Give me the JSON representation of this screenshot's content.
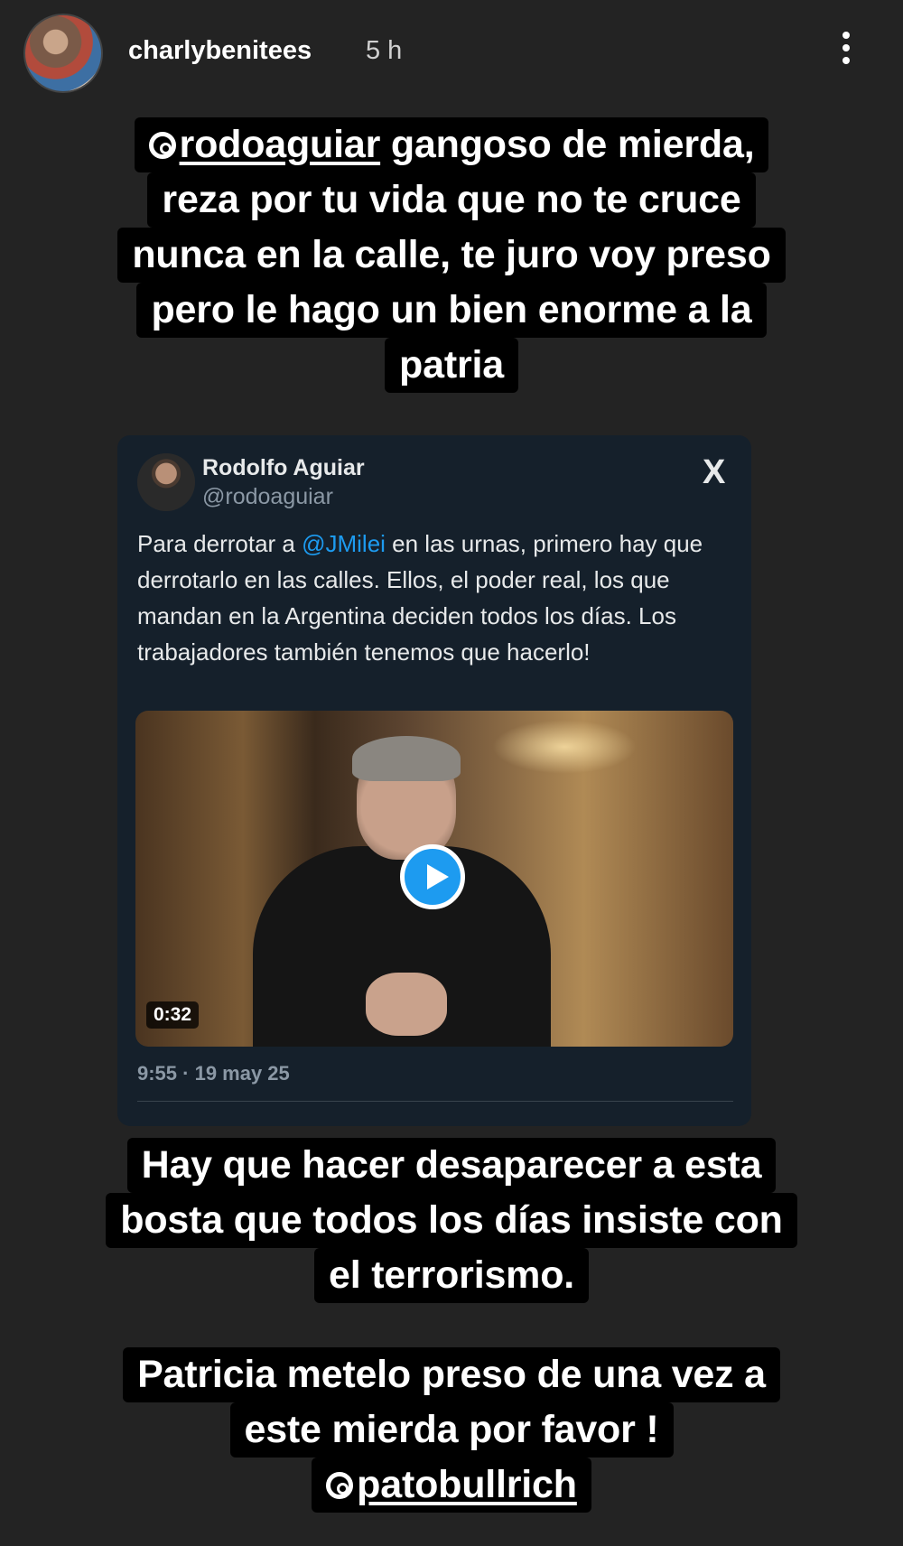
{
  "header": {
    "username": "charlybenitees",
    "time": "5 h"
  },
  "caption_top": {
    "mention": "rodoaguiar",
    "line1_rest": " gangoso de mierda,",
    "line2": "reza por tu vida que no te cruce",
    "line3": "nunca en la calle, te juro voy preso",
    "line4": "pero le hago un bien enorme a la",
    "line5": "patria"
  },
  "tweet": {
    "name": "Rodolfo Aguiar",
    "handle": "@rodoaguiar",
    "text_before": "Para derrotar a ",
    "text_mention": "@JMilei",
    "text_after": " en las urnas, primero hay que derrotarlo en las calles. Ellos, el poder real, los que mandan en la Argentina deciden todos los días. Los trabajadores también tenemos que hacerlo!",
    "video_duration": "0:32",
    "timestamp": "9:55 · 19 may 25",
    "logo": "X"
  },
  "caption_middle": {
    "line1": "Hay que hacer desaparecer a esta",
    "line2": "bosta que todos los días insiste con",
    "line3": "el terrorismo."
  },
  "caption_bottom": {
    "line1": "Patricia metelo preso de una vez a",
    "line2": "este mierda por favor !",
    "mention": "patobullrich"
  }
}
